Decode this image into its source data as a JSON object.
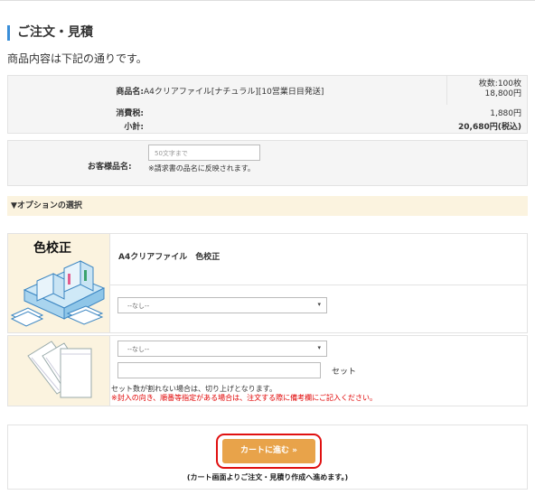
{
  "page": {
    "title": "ご注文・見積",
    "intro": "商品内容は下記の通りです。"
  },
  "summary": {
    "product_label": "商品名:",
    "product_name": "A4クリアファイル[ナチュラル][10営業日目発送]",
    "qty_line": "枚数:100枚",
    "price": "18,800円",
    "tax_label": "消費税:",
    "tax_value": "1,880円",
    "subtotal_label": "小計:",
    "subtotal_value": "20,680円(税込)"
  },
  "customer": {
    "label": "お客様品名:",
    "placeholder": "50文字まで",
    "note": "※請求書の品名に反映されます。"
  },
  "options": {
    "header": "▼オプションの選択",
    "color_proof": {
      "image_title": "色校正",
      "name": "A4クリアファイル　色校正",
      "select_value": "--なし--"
    },
    "packing": {
      "select_value": "--なし--",
      "set_label": "セット",
      "note1": "セット数が割れない場合は、切り上げとなります。",
      "note2": "※封入の向き、順番等指定がある場合は、注文する際に備考欄にご記入ください。"
    }
  },
  "cart": {
    "button_label": "カートに進む »",
    "note": "(カート画面よりご注文・見積り作成へ進めます。)"
  },
  "colors": {
    "accent": "#3a8ed8",
    "button": "#e8a34a",
    "highlight_ring": "#e01010",
    "warning_text": "#e00000",
    "option_bg": "#fbf3df"
  }
}
